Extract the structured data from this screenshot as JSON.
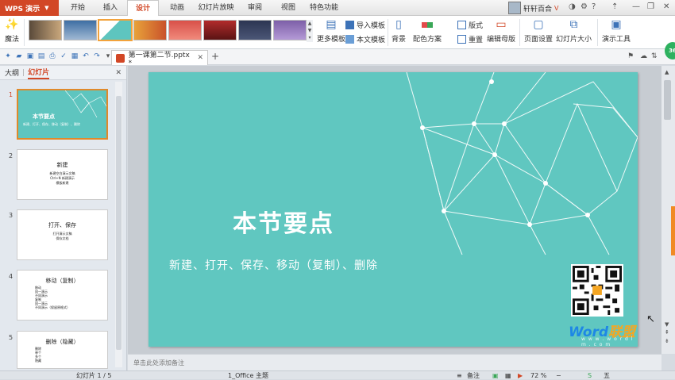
{
  "app": {
    "name": "WPS 演示"
  },
  "tabs": [
    "开始",
    "插入",
    "设计",
    "动画",
    "幻灯片放映",
    "审阅",
    "视图",
    "特色功能"
  ],
  "active_tab": "设计",
  "user": {
    "name": "轩轩百合"
  },
  "ribbon": {
    "magic_label": "魔法",
    "more_templates": "更多模板",
    "import_template": "导入模板",
    "this_template": "本文模板",
    "background": "背景",
    "color_scheme": "配色方案",
    "layout": "版式",
    "reset": "重置",
    "edit_master": "编辑母版",
    "page_setup": "页面设置",
    "slide_size": "幻灯片大小",
    "presentation_tools": "演示工具"
  },
  "document": {
    "tab_name": "第一课第二节.pptx *"
  },
  "panel": {
    "outline_label": "大纲",
    "slides_label": "幻灯片",
    "slides": [
      {
        "num": "1",
        "title": "本节要点",
        "lines": [
          "新建、打开、保存、移动（复制）、删除"
        ]
      },
      {
        "num": "2",
        "title": "新建",
        "lines": [
          "新建空白演示文稿",
          "Ctrl+N  新建演示",
          "模板新建"
        ]
      },
      {
        "num": "3",
        "title": "打开、保存",
        "lines": [
          "打开演示文稿",
          "保存文档"
        ]
      },
      {
        "num": "4",
        "title": "移动（复制）",
        "lines": [
          "移动",
          "同一演示",
          "不同演示",
          "复制",
          "同一演示",
          "不同演示（保留原格式）"
        ]
      },
      {
        "num": "5",
        "title": "删除（隐藏）",
        "lines": [
          "删除",
          "单个",
          "多个",
          "隐藏"
        ]
      }
    ]
  },
  "slide": {
    "title": "本节要点",
    "subtitle": "新建、打开、保存、移动（复制）、删除",
    "brand_en": "Word",
    "brand_cn": "联盟",
    "brand_url": "w w w . w o r d l m . c o m"
  },
  "notes_placeholder": "单击此处添加备注",
  "status": {
    "slide_counter": "幻灯片 1 / 5",
    "theme": "1_Office 主题",
    "notes": "备注",
    "zoom": "72 %"
  },
  "badge": {
    "value": "36"
  },
  "colors": {
    "accent": "#d24726",
    "slide_bg": "#60c7c0",
    "selection": "#e0892a"
  }
}
